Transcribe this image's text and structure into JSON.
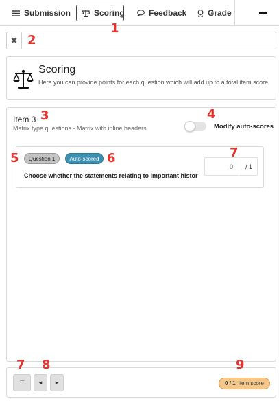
{
  "tabs": {
    "submission": "Submission",
    "scoring": "Scoring",
    "feedback": "Feedback",
    "grade": "Grade"
  },
  "search": {
    "close_glyph": "✖",
    "value": "",
    "placeholder": ""
  },
  "info": {
    "title": "Scoring",
    "description": "Here you can provide points for each question which will add up to a total item score",
    "icon": "scale-icon"
  },
  "item": {
    "title": "Item 3",
    "subtitle": "Matrix type questions - Matrix with inline headers",
    "toggle_label": "Modify auto-scores",
    "toggle_on": false
  },
  "question": {
    "badge": "Question 1",
    "auto_badge": "Auto-scored",
    "text": "Choose whether the statements relating to important historic",
    "score_value": "0",
    "score_max": "/ 1"
  },
  "footer": {
    "list_glyph": "☰",
    "prev_glyph": "◂",
    "next_glyph": "▸",
    "score_display": "0 / 1",
    "score_label": "Item score"
  },
  "markers": {
    "m1": "1",
    "m2": "2",
    "m3": "3",
    "m4": "4",
    "m5": "5",
    "m6": "6",
    "m7a": "7",
    "m7b": "7",
    "m8": "8",
    "m9": "9"
  },
  "colors": {
    "marker": "#e3342f",
    "auto_badge": "#3d8fb0",
    "score_pill": "#f4c78a"
  }
}
